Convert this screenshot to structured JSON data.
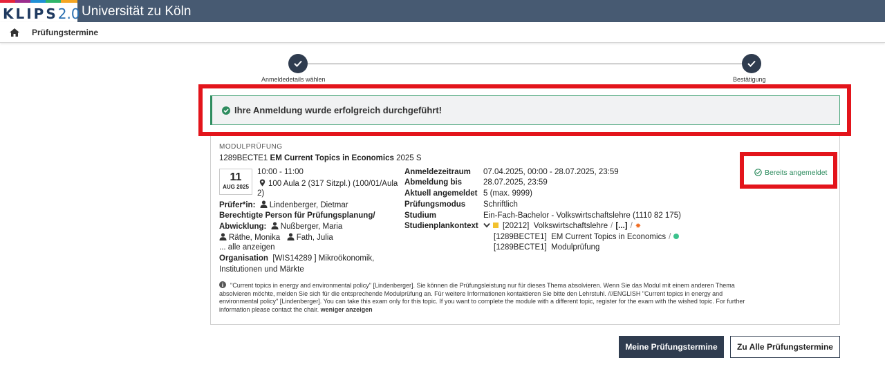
{
  "header": {
    "logo_main": "KLIPS",
    "logo_version": "2.0",
    "university": "Universität zu Köln",
    "stripe_colors": [
      "#e5243b",
      "#9b2d8e",
      "#1e90d6",
      "#2fb56a",
      "#f5a623"
    ]
  },
  "breadcrumb": {
    "icon": "home-icon",
    "title": "Prüfungstermine"
  },
  "stepper": {
    "steps": [
      {
        "label": "Anmeldedetails wählen",
        "done": true
      },
      {
        "label": "Bestätigung",
        "done": true
      }
    ]
  },
  "alert": {
    "icon": "check-circle-icon",
    "text": "Ihre Anmeldung wurde erfolgreich durchgeführt!"
  },
  "exam": {
    "type_label": "MODULPRÜFUNG",
    "code": "1289BECTE1",
    "title": "EM Current Topics in Economics",
    "semester": "2025 S",
    "date_day": "11",
    "date_month": "AUG 2025",
    "time": "10:00 - 11:00",
    "room_line1": "100 Aula 2 (317 Sitzpl.) (100/01/Aula",
    "room_line2": "2)",
    "examiner_label": "Prüfer*in:",
    "examiner": "Lindenberger, Dietmar",
    "authorized_label_1": "Berechtigte Person für Prüfungsplanung/",
    "authorized_label_2": "Abwicklung:",
    "authorized_1": "Nußberger, Maria",
    "authorized_2": "Räthe, Monika",
    "authorized_3": "Fath, Julia",
    "show_all": "... alle anzeigen",
    "org_label": "Organisation",
    "org_line1": "[WIS14289 ] Mikroökonomik,",
    "org_line2": "Institutionen und Märkte",
    "status": "Bereits angemeldet",
    "details": [
      {
        "label": "Anmeldezeitraum",
        "value": "07.04.2025, 00:00 - 28.07.2025, 23:59"
      },
      {
        "label": "Abmeldung bis",
        "value": "28.07.2025, 23:59"
      },
      {
        "label": "Aktuell angemeldet",
        "value": "5 (max. 9999)"
      },
      {
        "label": "Prüfungsmodus",
        "value": "Schriftlich"
      },
      {
        "label": "Studium",
        "value": "Ein-Fach-Bachelor - Volkswirtschaftslehre (1110 82 175)"
      },
      {
        "label": "Studienplankontext",
        "value": ""
      }
    ],
    "context": {
      "line1_code": "[20212]",
      "line1_name": "Volkswirtschaftslehre",
      "line1_more": "[...]",
      "line2_code": "[1289BECTE1]",
      "line2_name": "EM Current Topics in Economics",
      "line3_code": "[1289BECTE1]",
      "line3_name": "Modulprüfung"
    },
    "info_line1": "\"Current topics in energy and environmental policy\" [Lindenberger].  Sie können die Prüfungsleistung nur für dieses Thema absolvieren. Wenn Sie das Modul mit einem anderen Thema",
    "info_line2": "absolvieren möchte, melden Sie sich für die entsprechende Modulprüfung an. Für weitere Informationen kontaktieren Sie bitte den Lehrstuhl.   ///ENGLISH  \"Current topics in energy and",
    "info_line3": "environmental policy\" [Lindenberger].  You can take this exam only for this topic. If you want to complete the module with a different topic, register for the exam with the wished topic. For further",
    "info_line4": "information please contact the chair.",
    "show_less": "weniger anzeigen"
  },
  "buttons": {
    "my_exams": "Meine Prüfungstermine",
    "all_exams": "Zu Alle Prüfungstermine"
  },
  "highlight_color": "#e3141b"
}
